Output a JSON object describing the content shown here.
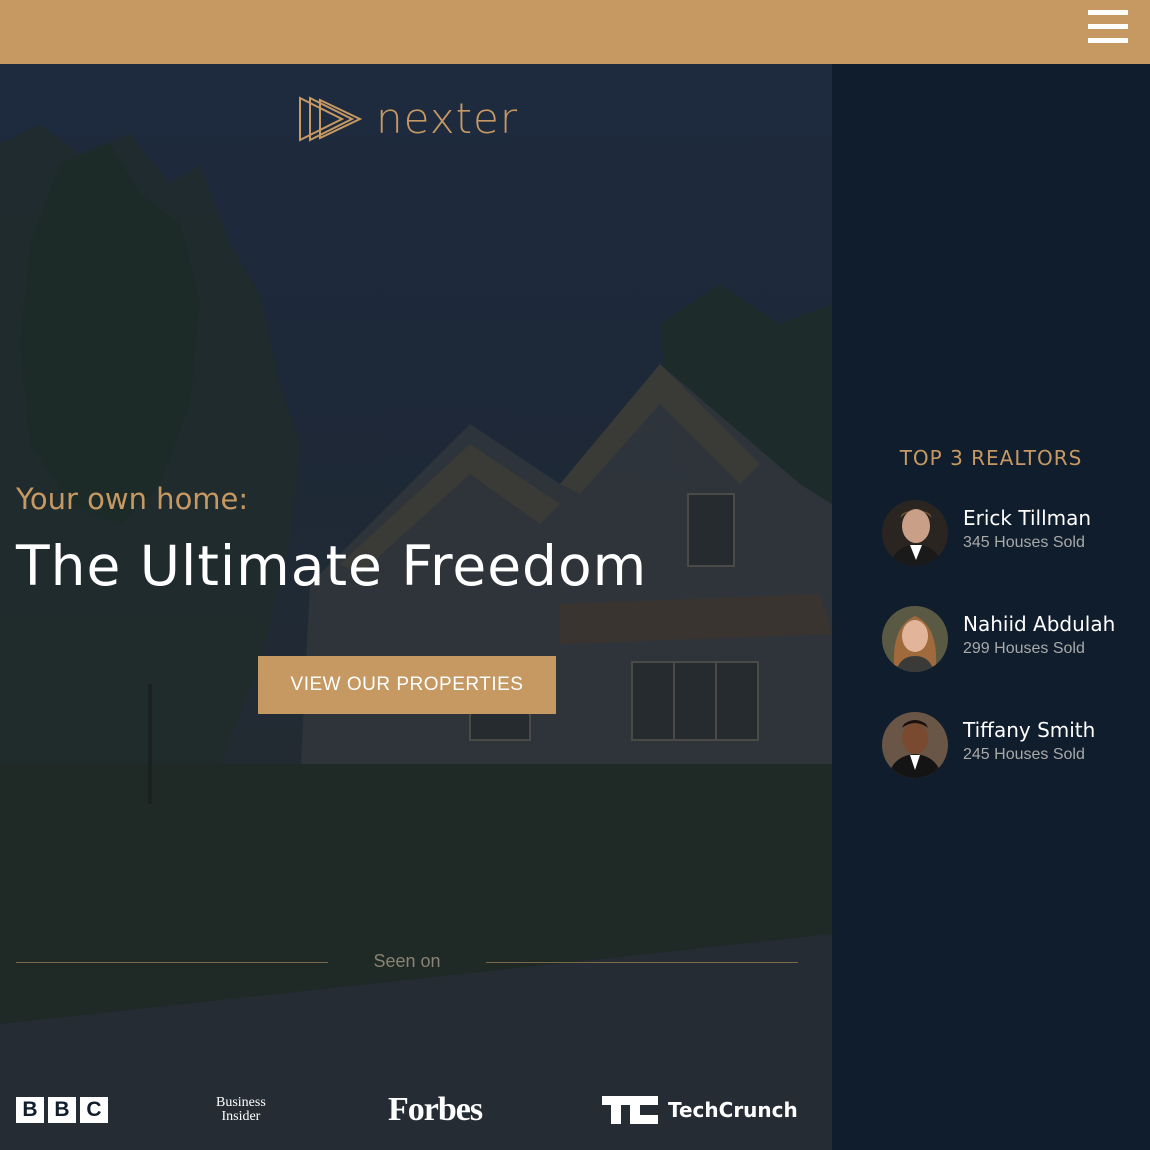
{
  "header": {
    "menu_icon": "hamburger-menu-icon",
    "bg_color": "#c69963"
  },
  "hero": {
    "logo_text": "nexter",
    "logo_icon": "triple-play-triangle-icon",
    "pretitle": "Your own home:",
    "title": "The Ultimate Freedom",
    "cta_label": "VIEW OUR PROPERTIES",
    "seen_on_label": "Seen on",
    "publications": [
      {
        "name": "BBC",
        "letters": [
          "B",
          "B",
          "C"
        ]
      },
      {
        "name": "Business Insider",
        "line1": "Business",
        "line2": "Insider"
      },
      {
        "name": "Forbes"
      },
      {
        "name": "TechCrunch",
        "mark": "TC",
        "word": "TechCrunch"
      }
    ]
  },
  "sidebar": {
    "title": "TOP 3 REALTORS",
    "realtors": [
      {
        "name": "Erick Tillman",
        "sold": "345 Houses Sold"
      },
      {
        "name": "Nahiid Abdulah",
        "sold": "299 Houses Sold"
      },
      {
        "name": "Tiffany Smith",
        "sold": "245 Houses Sold"
      }
    ]
  },
  "colors": {
    "primary": "#c69963",
    "dark": "#101d2c",
    "white": "#ffffff",
    "muted": "#a9a9a9"
  }
}
